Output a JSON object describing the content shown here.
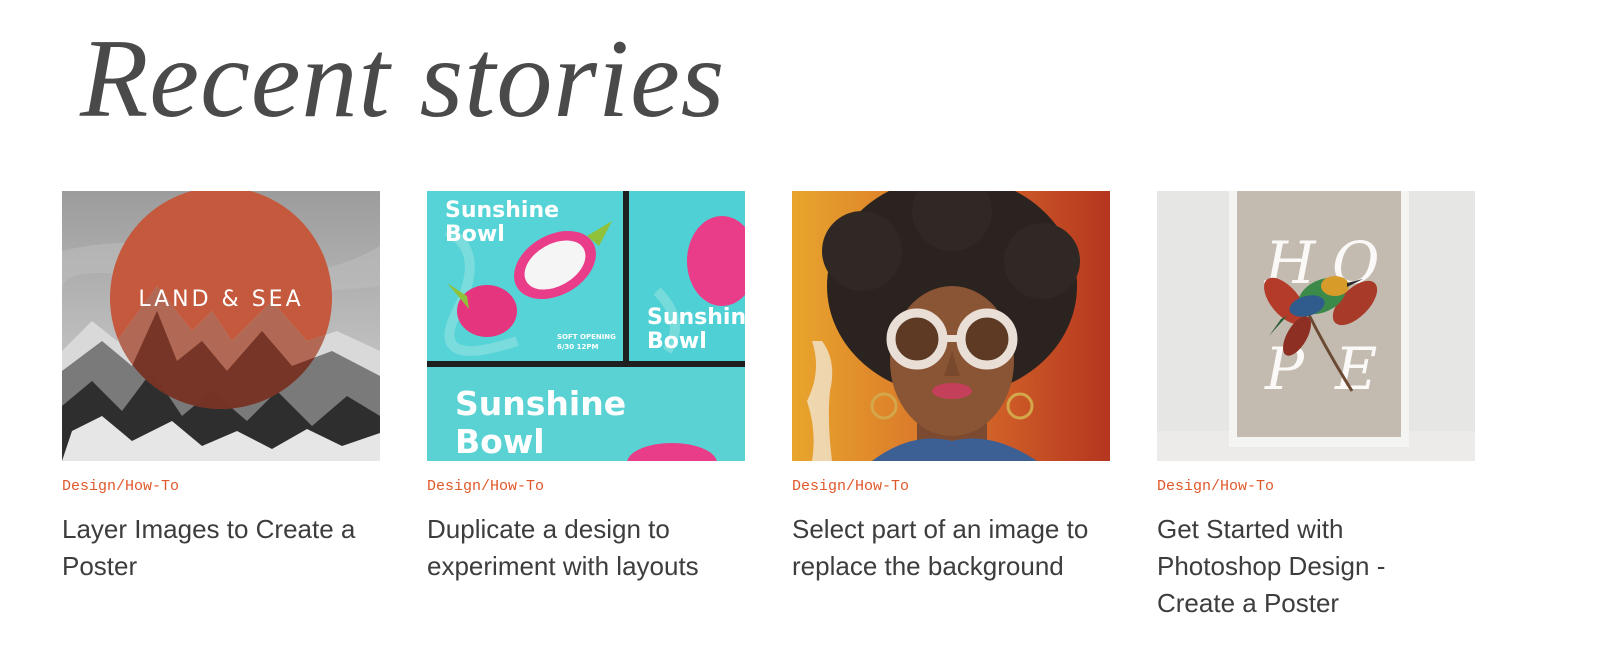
{
  "section": {
    "title": "Recent stories"
  },
  "stories": [
    {
      "category": "Design/How-To",
      "title": "Layer Images to Create a Poster",
      "image": {
        "icon": "land-and-sea-poster-image",
        "overlay_text": "LAND & SEA",
        "accent": "#c4593d"
      }
    },
    {
      "category": "Design/How-To",
      "title": "Duplicate a design to experiment with layouts",
      "image": {
        "icon": "sunshine-bowl-layouts-image",
        "text_main": "Sunshine Bowl",
        "text_small": "SOFT OPENING",
        "text_date": "6/30 12PM",
        "accent": "#4fd0d4"
      }
    },
    {
      "category": "Design/How-To",
      "title": "Select part of an image to replace the background",
      "image": {
        "icon": "portrait-woman-sunglasses-image",
        "accent": "#e5a32d"
      }
    },
    {
      "category": "Design/How-To",
      "title": "Get Started with Photoshop Design - Create a Poster",
      "image": {
        "icon": "hope-bird-poster-image",
        "letters": [
          "H",
          "O",
          "P",
          "E"
        ],
        "accent": "#c4bbb0"
      }
    }
  ],
  "colors": {
    "category": "#e0582a",
    "title": "#3d3d3d",
    "heading": "#4a4a4a"
  }
}
